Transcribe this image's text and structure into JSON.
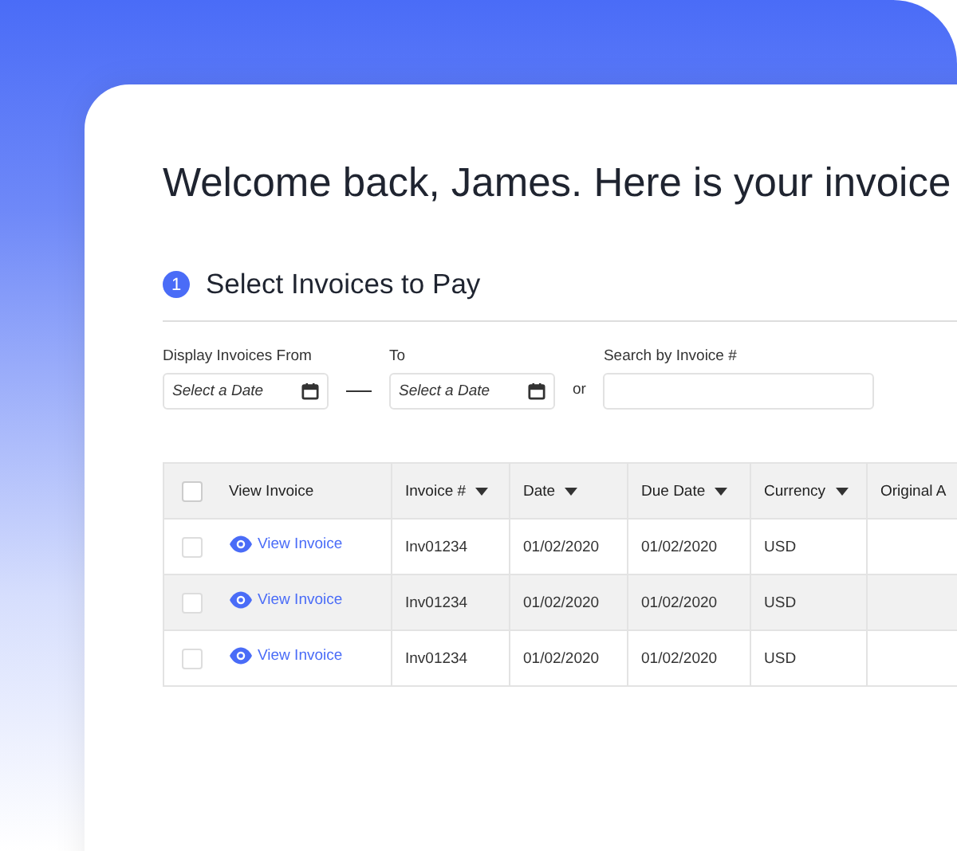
{
  "heading": "Welcome back, James. Here is your invoice",
  "step": {
    "number": "1",
    "title": "Select Invoices to Pay"
  },
  "filters": {
    "from_label": "Display Invoices From",
    "from_placeholder": "Select a Date",
    "to_label": "To",
    "to_placeholder": "Select a Date",
    "or": "or",
    "search_label": "Search by Invoice #"
  },
  "table": {
    "select_all": {
      "checked": false
    },
    "columns": [
      {
        "label": "View Invoice",
        "sortable": false
      },
      {
        "label": "Invoice #",
        "sortable": true
      },
      {
        "label": "Date",
        "sortable": true
      },
      {
        "label": "Due Date",
        "sortable": true
      },
      {
        "label": "Currency",
        "sortable": true
      },
      {
        "label": "Original A",
        "sortable": false
      }
    ],
    "rows": [
      {
        "checked": false,
        "cells": [
          "View Invoice",
          "Inv01234",
          "01/02/2020",
          "01/02/2020",
          "USD"
        ]
      },
      {
        "checked": false,
        "cells": [
          "View Invoice",
          "Inv01234",
          "01/02/2020",
          "01/02/2020",
          "USD"
        ]
      },
      {
        "checked": false,
        "cells": [
          "View Invoice",
          "Inv01234",
          "01/02/2020",
          "01/02/2020",
          "USD"
        ]
      }
    ]
  }
}
